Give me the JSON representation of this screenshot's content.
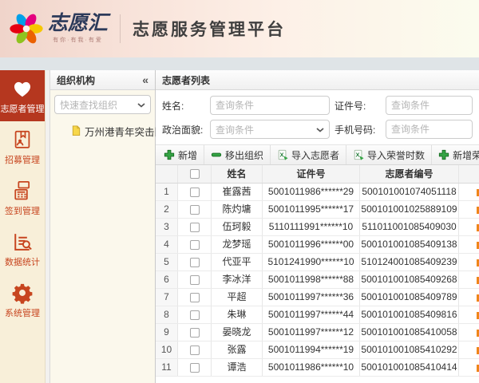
{
  "banner": {
    "logo_text": "志愿汇",
    "logo_tagline": "有你·有我·有爱",
    "title": "志愿服务管理平台"
  },
  "sidebar": {
    "items": [
      {
        "key": "volunteers",
        "label": "志愿者管理",
        "icon": "heart-hand-icon",
        "active": true
      },
      {
        "key": "recruit",
        "label": "招募管理",
        "icon": "recruit-icon",
        "active": false
      },
      {
        "key": "checkin",
        "label": "签到管理",
        "icon": "checkin-icon",
        "active": false
      },
      {
        "key": "stats",
        "label": "数据统计",
        "icon": "stats-icon",
        "active": false
      },
      {
        "key": "system",
        "label": "系统管理",
        "icon": "gear-icon",
        "active": false
      }
    ]
  },
  "org_panel": {
    "title": "组织机构",
    "collapse_icon": "«",
    "search_placeholder": "快速查找组织",
    "tree_items": [
      {
        "label": "万州港青年突击队",
        "icon": "document-icon"
      }
    ]
  },
  "main": {
    "title": "志愿者列表",
    "filters": [
      {
        "key": "name",
        "label": "姓名:",
        "placeholder": "查询条件",
        "type": "text"
      },
      {
        "key": "idnumber",
        "label": "证件号:",
        "placeholder": "查询条件",
        "type": "text"
      },
      {
        "key": "politics",
        "label": "政治面貌:",
        "placeholder": "查询条件",
        "type": "select"
      },
      {
        "key": "phone",
        "label": "手机号码:",
        "placeholder": "查询条件",
        "type": "text"
      }
    ],
    "toolbar": [
      {
        "key": "add",
        "label": "新增",
        "icon": "plus-icon"
      },
      {
        "key": "remove-from-org",
        "label": "移出组织",
        "icon": "minus-icon"
      },
      {
        "key": "import-volunteers",
        "label": "导入志愿者",
        "icon": "excel-icon"
      },
      {
        "key": "import-honor-hours",
        "label": "导入荣誉时数",
        "icon": "excel-icon"
      },
      {
        "key": "add-honor-hours",
        "label": "新增荣誉时数",
        "icon": "plus-icon"
      }
    ],
    "table": {
      "columns": [
        "姓名",
        "证件号",
        "志愿者编号"
      ],
      "rows": [
        {
          "index": "1",
          "name": "崔露茜",
          "id_number": "5001011986******29",
          "volunteer_no": "500101001074051118"
        },
        {
          "index": "2",
          "name": "陈灼墉",
          "id_number": "5001011995******17",
          "volunteer_no": "500101001025889109"
        },
        {
          "index": "3",
          "name": "伍珂毅",
          "id_number": "5110111991******10",
          "volunteer_no": "511011001085409030"
        },
        {
          "index": "4",
          "name": "龙梦瑶",
          "id_number": "5001011996******00",
          "volunteer_no": "500101001085409138"
        },
        {
          "index": "5",
          "name": "代亚平",
          "id_number": "5101241990******10",
          "volunteer_no": "510124001085409239"
        },
        {
          "index": "6",
          "name": "李冰洋",
          "id_number": "5001011998******88",
          "volunteer_no": "500101001085409268"
        },
        {
          "index": "7",
          "name": "平超",
          "id_number": "5001011997******36",
          "volunteer_no": "500101001085409789"
        },
        {
          "index": "8",
          "name": "朱琳",
          "id_number": "5001011997******44",
          "volunteer_no": "500101001085409816"
        },
        {
          "index": "9",
          "name": "晏晓龙",
          "id_number": "5001011997******12",
          "volunteer_no": "500101001085410058"
        },
        {
          "index": "10",
          "name": "张露",
          "id_number": "5001011994******19",
          "volunteer_no": "500101001085410292"
        },
        {
          "index": "11",
          "name": "谭浩",
          "id_number": "5001011986******10",
          "volunteer_no": "500101001085410414"
        }
      ]
    }
  },
  "colors": {
    "accent_red": "#b5371f",
    "sidebar_bg": "#f8efd9",
    "sidebar_text": "#c7451f",
    "banner_left": "#f0d4ca",
    "banner_right": "#fbfcee",
    "strip": "#dfe4e7",
    "toolbar_icon_green": "#35a445",
    "clipped_action_orange": "#f08519",
    "doc_icon_yellow": "#f7d74a"
  }
}
